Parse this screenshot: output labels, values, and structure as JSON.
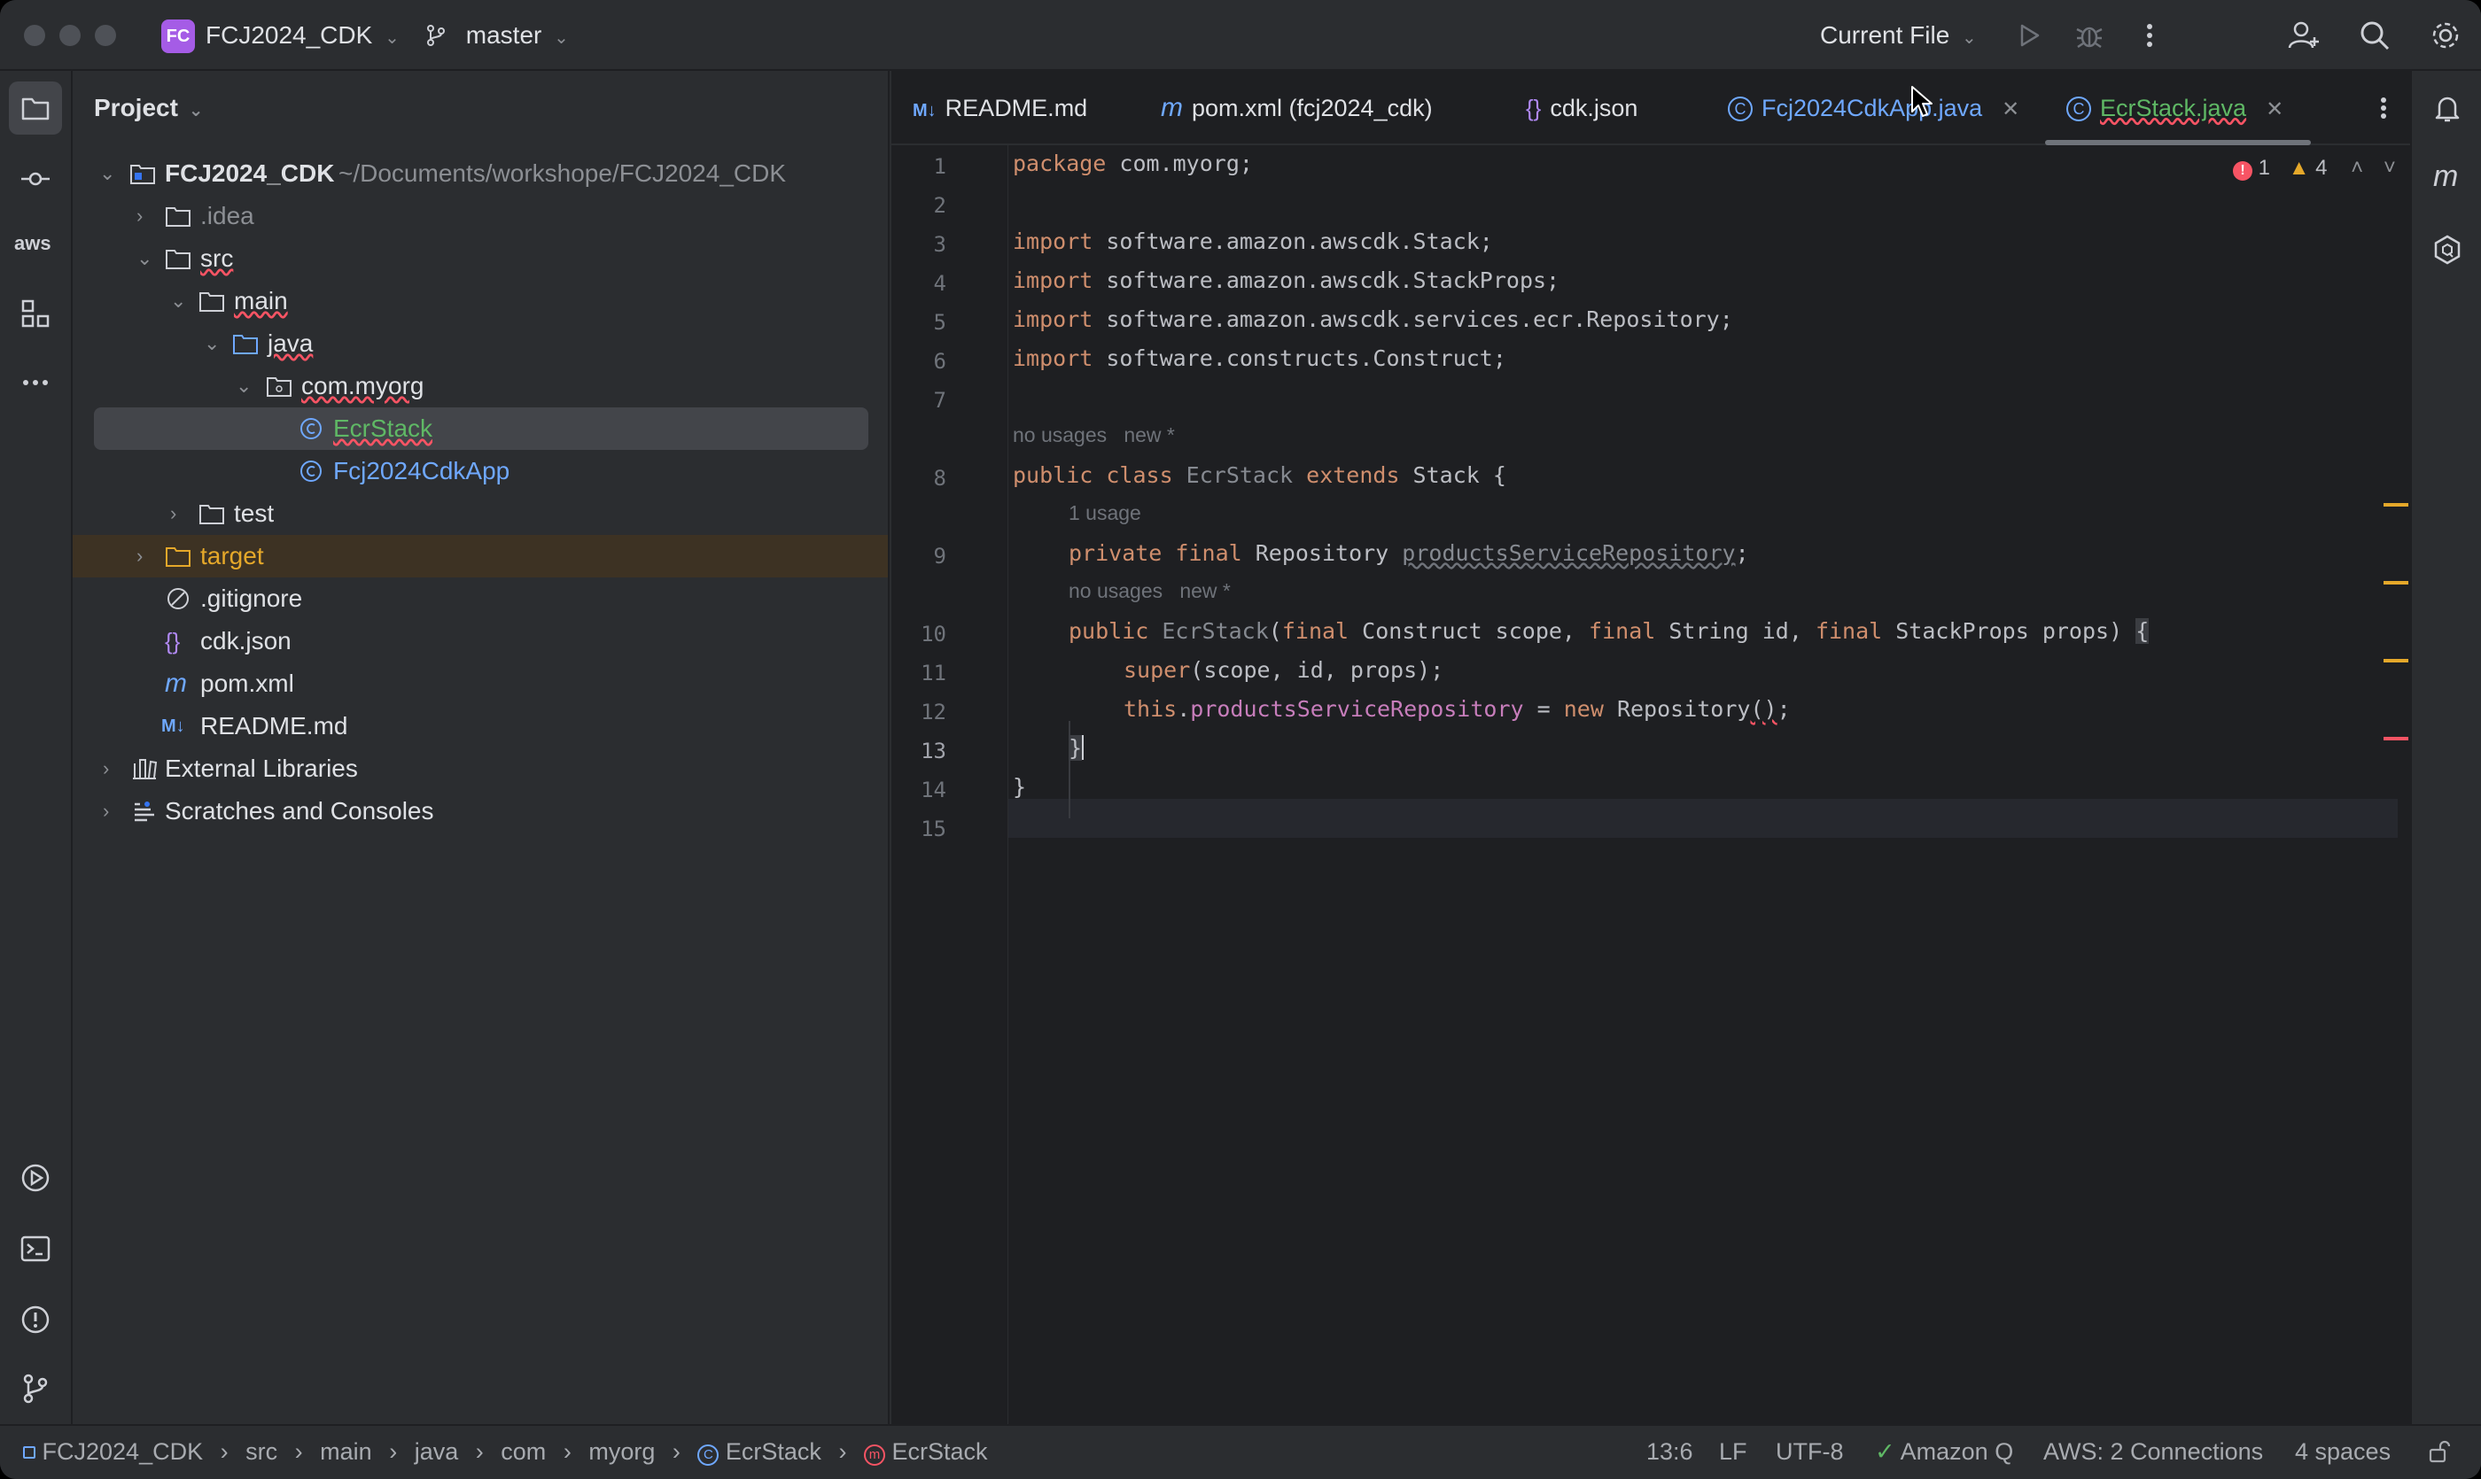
{
  "titlebar": {
    "project_badge": "FC",
    "project_name": "FCJ2024_CDK",
    "branch": "master",
    "run_config": "Current File"
  },
  "project_pane": {
    "title": "Project",
    "root_name": "FCJ2024_CDK",
    "root_path": "~/Documents/workshope/FCJ2024_CDK",
    "items": [
      {
        "label": "FCJ2024_CDK"
      },
      {
        "label": ".idea"
      },
      {
        "label": "src"
      },
      {
        "label": "main"
      },
      {
        "label": "java"
      },
      {
        "label": "com.myorg"
      },
      {
        "label": "EcrStack"
      },
      {
        "label": "Fcj2024CdkApp"
      },
      {
        "label": "test"
      },
      {
        "label": "target"
      },
      {
        "label": ".gitignore"
      },
      {
        "label": "cdk.json"
      },
      {
        "label": "pom.xml"
      },
      {
        "label": "README.md"
      },
      {
        "label": "External Libraries"
      },
      {
        "label": "Scratches and Consoles"
      }
    ]
  },
  "tabs": [
    {
      "label": "README.md",
      "icon": "M↓"
    },
    {
      "label": "pom.xml (fcj2024_cdk)",
      "icon": "m"
    },
    {
      "label": "cdk.json",
      "icon": "{}"
    },
    {
      "label": "Fcj2024CdkApp.java",
      "icon": "C"
    },
    {
      "label": "EcrStack.java",
      "icon": "C"
    }
  ],
  "inspection": {
    "errors": "1",
    "warnings": "4"
  },
  "editor": {
    "line_numbers": [
      "1",
      "2",
      "3",
      "4",
      "5",
      "6",
      "7",
      "8",
      "9",
      "10",
      "11",
      "12",
      "13",
      "14",
      "15"
    ],
    "current_line": "13",
    "lines": {
      "l1_kw": "package",
      "l1_rest": " com.myorg;",
      "l3_kw": "import",
      "l3_rest": " software.amazon.awscdk.Stack;",
      "l4_kw": "import",
      "l4_rest": " software.amazon.awscdk.StackProps;",
      "l5_kw": "import",
      "l5_rest": " software.amazon.awscdk.services.ecr.Repository;",
      "l6_kw": "import",
      "l6_rest": " software.constructs.Construct;",
      "hint1_a": "no usages",
      "hint1_b": "new *",
      "l8_kw1": "public class",
      "l8_name": " EcrStack ",
      "l8_kw2": "extends",
      "l8_rest": " Stack {",
      "hint2": "1 usage",
      "l9_kw": "private final",
      "l9_type": " Repository ",
      "l9_field": "productsServiceRepository",
      "l9_end": ";",
      "hint3_a": "no usages",
      "hint3_b": "new *",
      "l10_kw": "public",
      "l10_name": " EcrStack",
      "l10_p1": "(",
      "l10_f1": "final",
      "l10_t1": " Construct scope, ",
      "l10_f2": "final",
      "l10_t2": " String id, ",
      "l10_f3": "final",
      "l10_t3": " StackProps props) ",
      "l10_brace": "{",
      "l11_kw": "super",
      "l11_rest": "(scope, id, props);",
      "l12_kw": "this",
      "l12_dot": ".",
      "l12_field": "productsServiceRepository",
      "l12_eq": " = ",
      "l12_new": "new",
      "l12_type": " Repository",
      "l12_paren": "()",
      "l12_end": ";",
      "l13": "}",
      "l14": "}"
    }
  },
  "statusbar": {
    "breadcrumbs": [
      "FCJ2024_CDK",
      "src",
      "main",
      "java",
      "com",
      "myorg",
      "EcrStack",
      "EcrStack"
    ],
    "position": "13:6",
    "line_sep": "LF",
    "encoding": "UTF-8",
    "amazon_q": "Amazon Q",
    "aws": "AWS: 2 Connections",
    "indent": "4 spaces"
  },
  "colors": {
    "accent": "#3574f0",
    "keyword": "#cf8e6d",
    "field": "#c77dbb",
    "error": "#f75464",
    "warning": "#e5a82a",
    "vcs_added": "#5fb865",
    "class_blue": "#6fa8ff"
  }
}
